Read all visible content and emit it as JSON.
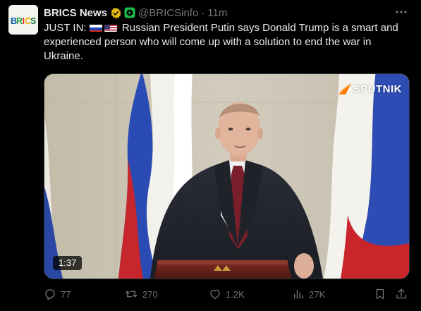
{
  "author": {
    "name": "BRICS News",
    "handle": "@BRICSinfo",
    "time": "11m",
    "avatar_text": "BRICS"
  },
  "post": {
    "prefix": "JUST IN:",
    "flags": [
      "russia-flag",
      "usa-flag"
    ],
    "body": "Russian President Putin says Donald Trump is a smart and experienced person who will come up with a solution to end the war in Ukraine."
  },
  "media": {
    "watermark": "SPUTNIK",
    "duration": "1:37"
  },
  "actions": {
    "replies": "77",
    "reposts": "270",
    "likes": "1.2K",
    "views": "27K"
  },
  "colors": {
    "background": "#000000",
    "text": "#e7e9ea",
    "muted": "#71767b",
    "verified": "#e2b719",
    "affiliate": "#1fb84a",
    "sputnik_orange": "#ff7a00"
  },
  "icons": [
    "verified-badge-icon",
    "affiliate-icon",
    "more-icon",
    "reply-icon",
    "repost-icon",
    "like-icon",
    "views-icon",
    "bookmark-icon",
    "share-icon"
  ]
}
